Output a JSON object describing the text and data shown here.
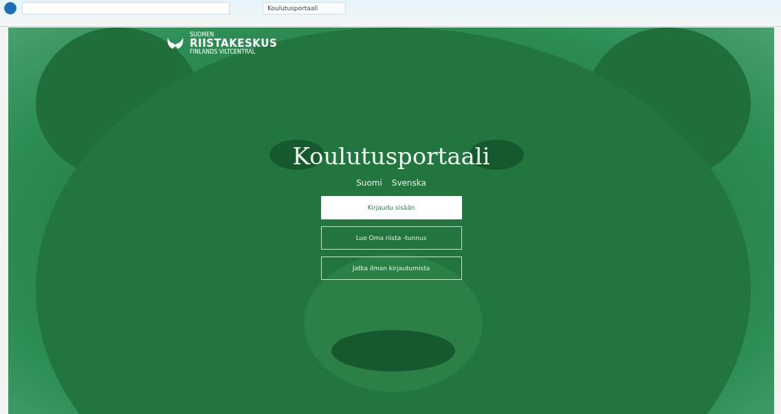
{
  "browser": {
    "tab_title": "Koulutusportaali"
  },
  "logo": {
    "small_top": "SUOMEN",
    "name": "RIISTAKESKUS",
    "small_bottom": "FINLANDS VILTCENTRAL"
  },
  "title": "Koulutusportaali",
  "languages": [
    {
      "label": "Suomi"
    },
    {
      "label": "Svenska"
    }
  ],
  "buttons": [
    {
      "label": "Kirjaudu sisään",
      "kind": "primary"
    },
    {
      "label": "Luo Oma riista -tunnus",
      "kind": "outline"
    },
    {
      "label": "Jatka ilman kirjautumista",
      "kind": "outline"
    }
  ]
}
